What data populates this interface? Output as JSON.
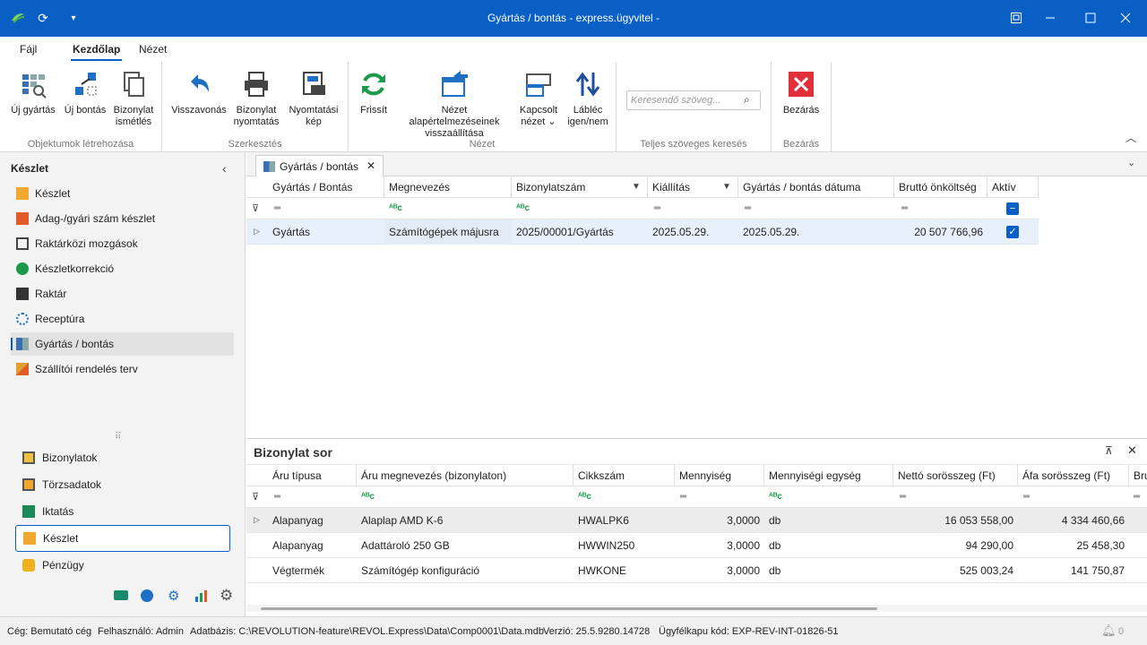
{
  "window": {
    "title": "Gyártás / bontás - express.ügyvitel -"
  },
  "menu": {
    "tabs": [
      "Fájl",
      "Kezdőlap",
      "Nézet"
    ]
  },
  "ribbon": {
    "groups": {
      "create": {
        "label": "Objektumok létrehozása",
        "b1": "Új gyártás",
        "b2": "Új bontás",
        "b3a": "Bizonylat",
        "b3b": "ismétlés"
      },
      "edit": {
        "label": "Szerkesztés",
        "b1": "Visszavonás",
        "b2a": "Bizonylat",
        "b2b": "nyomtatás",
        "b3a": "Nyomtatási",
        "b3b": "kép"
      },
      "view": {
        "label": "Nézet",
        "b1": "Frissít",
        "b2a": "Nézet alapértelmezéseinek",
        "b2b": "visszaállítása",
        "b3a": "Kapcsolt",
        "b3b": "nézet ⌄",
        "b4a": "Lábléc",
        "b4b": "igen/nem"
      },
      "search": {
        "label": "Teljes szöveges keresés",
        "placeholder": "Keresendő szöveg..."
      },
      "close": {
        "label": "Bezárás",
        "b1": "Bezárás"
      }
    }
  },
  "sidebar": {
    "title": "Készlet",
    "items": [
      "Készlet",
      "Adag-/gyári szám készlet",
      "Raktárközi mozgások",
      "Készletkorrekció",
      "Raktár",
      "Receptúra",
      "Gyártás / bontás",
      "Szállítói rendelés terv"
    ],
    "modules": [
      "Bizonylatok",
      "Törzsadatok",
      "Iktatás",
      "Készlet",
      "Pénzügy"
    ]
  },
  "doctab": {
    "label": "Gyártás / bontás"
  },
  "main_grid": {
    "columns": [
      "Gyártás / Bontás",
      "Megnevezés",
      "Bizonylatszám",
      "Kiállítás",
      "Gyártás / bontás dátuma",
      "Bruttó önköltség",
      "Aktív"
    ],
    "rows": [
      {
        "type": "Gyártás",
        "name": "Számítógépek májusra",
        "doc": "2025/00001/Gyártás",
        "issued": "2025.05.29.",
        "date": "2025.05.29.",
        "cost": "20 507 766,96",
        "active": true
      }
    ]
  },
  "detail": {
    "title": "Bizonylat sor",
    "columns": [
      "Áru típusa",
      "Áru megnevezés (bizonylaton)",
      "Cikkszám",
      "Mennyiség",
      "Mennyiségi egység",
      "Nettó sorösszeg (Ft)",
      "Áfa sorösszeg (Ft)",
      "Bru"
    ],
    "rows": [
      {
        "type": "Alapanyag",
        "name": "Alaplap AMD K-6",
        "sku": "HWALPK6",
        "qty": "3,0000",
        "unit": "db",
        "net": "16 053 558,00",
        "vat": "4 334 460,66"
      },
      {
        "type": "Alapanyag",
        "name": "Adattároló 250 GB",
        "sku": "HWWIN250",
        "qty": "3,0000",
        "unit": "db",
        "net": "94 290,00",
        "vat": "25 458,30"
      },
      {
        "type": "Végtermék",
        "name": "Számítógép konfiguráció",
        "sku": "HWKONE",
        "qty": "3,0000",
        "unit": "db",
        "net": "525 003,24",
        "vat": "141 750,87"
      }
    ]
  },
  "status": {
    "company": "Cég: Bemutató cég",
    "user": "Felhasználó: Admin",
    "db": "Adatbázis: C:\\REVOLUTION-feature\\REVOL.Express\\Data\\Comp0001\\Data.mdb",
    "version": "Verzió: 25.5.9280.14728",
    "portal": "Ügyfélkapu kód: EXP-REV-INT-01826-51",
    "notifications": "0"
  },
  "colors": {
    "accent": "#0a5fc4",
    "close_red": "#e0303a",
    "green": "#1a9a4a"
  }
}
